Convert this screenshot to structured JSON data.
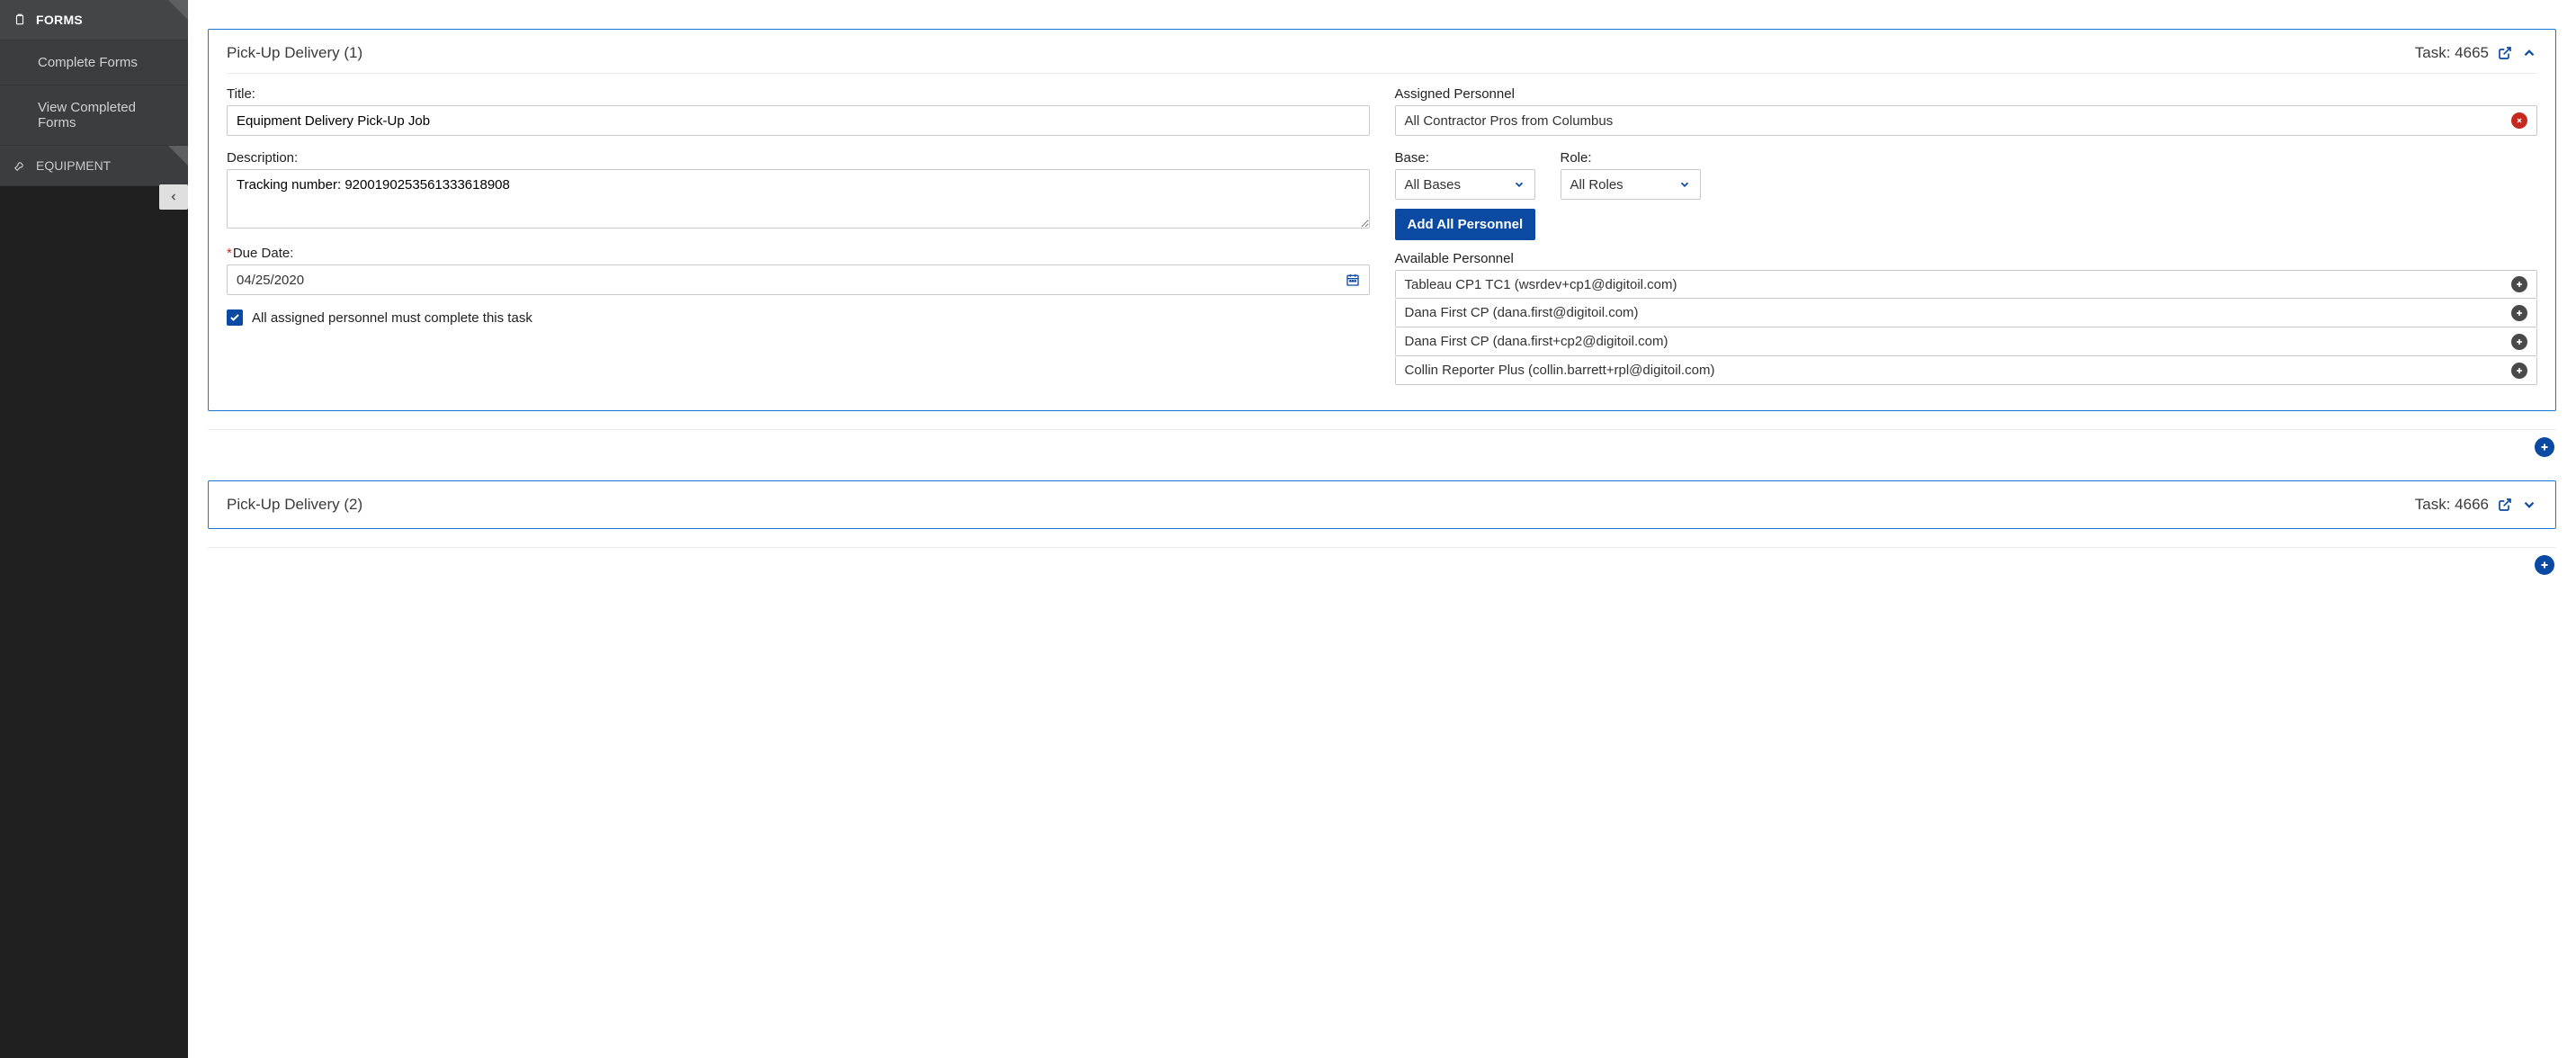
{
  "sidebar": {
    "forms": {
      "label": "FORMS",
      "items": [
        {
          "label": "Complete Forms"
        },
        {
          "label": "View Completed Forms"
        }
      ]
    },
    "equipment": {
      "label": "EQUIPMENT"
    }
  },
  "cards": [
    {
      "title": "Pick-Up Delivery (1)",
      "task_label": "Task: 4665",
      "expanded": true,
      "form": {
        "title_label": "Title:",
        "title_value": "Equipment Delivery Pick-Up Job",
        "desc_label": "Description:",
        "desc_value": "Tracking number: 9200190253561333618908",
        "due_label": "Due Date:",
        "due_value": "04/25/2020",
        "check_label": "All assigned personnel must complete this task",
        "assigned_label": "Assigned Personnel",
        "assigned_value": "All Contractor Pros from Columbus",
        "base_label": "Base:",
        "base_value": "All Bases",
        "role_label": "Role:",
        "role_value": "All Roles",
        "add_all_label": "Add All Personnel",
        "avail_label": "Available Personnel",
        "people": [
          {
            "label": "Tableau CP1 TC1 (wsrdev+cp1@digitoil.com)"
          },
          {
            "label": "Dana First CP (dana.first@digitoil.com)"
          },
          {
            "label": "Dana First CP (dana.first+cp2@digitoil.com)"
          },
          {
            "label": "Collin Reporter Plus (collin.barrett+rpl@digitoil.com)"
          }
        ]
      }
    },
    {
      "title": "Pick-Up Delivery (2)",
      "task_label": "Task: 4666",
      "expanded": false
    }
  ]
}
